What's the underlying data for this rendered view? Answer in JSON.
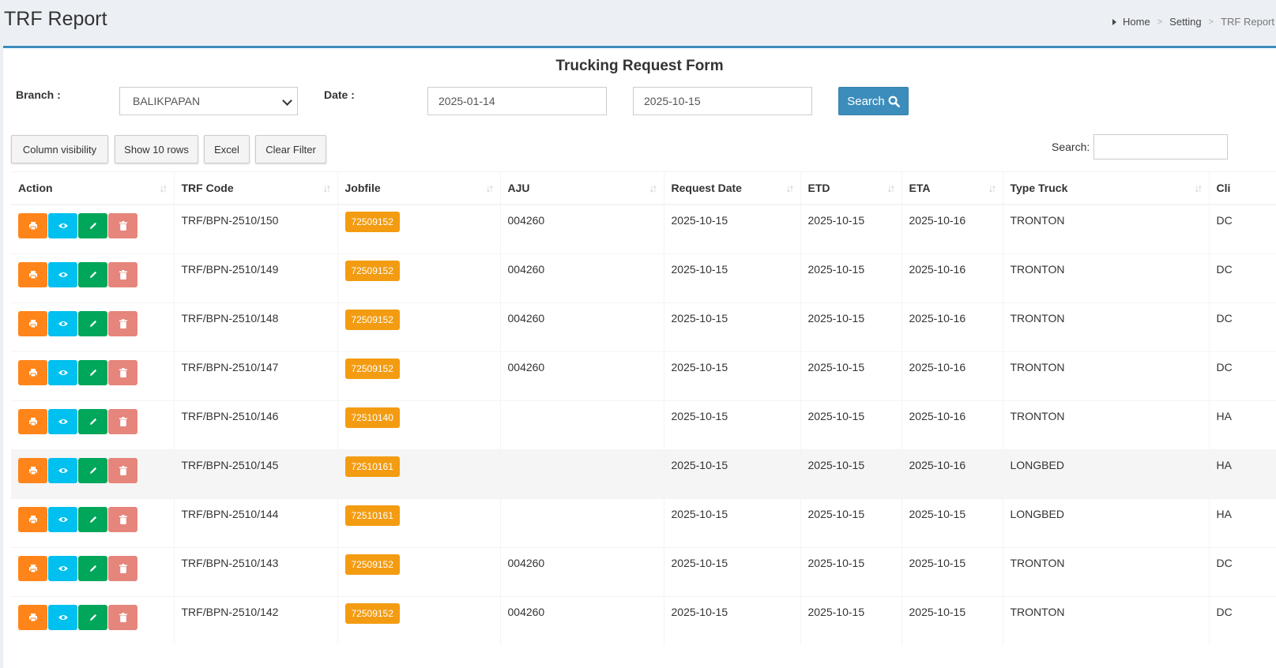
{
  "page": {
    "title": "TRF Report"
  },
  "breadcrumb": {
    "items": [
      "Home",
      "Setting",
      "TRF Report"
    ]
  },
  "form": {
    "title": "Trucking Request Form",
    "branch_label": "Branch :",
    "branch_value": "BALIKPAPAN",
    "date_label": "Date :",
    "date_from": "2025-01-14",
    "date_to": "2025-10-15",
    "search_button": "Search"
  },
  "toolbar": {
    "column_visibility": "Column visibility",
    "show_rows": "Show 10 rows",
    "excel": "Excel",
    "clear_filter": "Clear Filter",
    "search_label": "Search:",
    "search_value": ""
  },
  "colors": {
    "accent": "#3c8dbc",
    "print": "#ff851b",
    "view": "#00c0ef",
    "edit": "#00a65a",
    "delete": "#e6857b",
    "jobfile": "#f39c12"
  },
  "table": {
    "columns": [
      "Action",
      "TRF Code",
      "Jobfile",
      "AJU",
      "Request Date",
      "ETD",
      "ETA",
      "Type Truck",
      "Cli"
    ],
    "rows": [
      {
        "trf_code": "TRF/BPN-2510/150",
        "jobfile": "72509152",
        "aju": "004260",
        "request_date": "2025-10-15",
        "etd": "2025-10-15",
        "eta": "2025-10-16",
        "type_truck": "TRONTON",
        "client": "DC"
      },
      {
        "trf_code": "TRF/BPN-2510/149",
        "jobfile": "72509152",
        "aju": "004260",
        "request_date": "2025-10-15",
        "etd": "2025-10-15",
        "eta": "2025-10-16",
        "type_truck": "TRONTON",
        "client": "DC"
      },
      {
        "trf_code": "TRF/BPN-2510/148",
        "jobfile": "72509152",
        "aju": "004260",
        "request_date": "2025-10-15",
        "etd": "2025-10-15",
        "eta": "2025-10-16",
        "type_truck": "TRONTON",
        "client": "DC"
      },
      {
        "trf_code": "TRF/BPN-2510/147",
        "jobfile": "72509152",
        "aju": "004260",
        "request_date": "2025-10-15",
        "etd": "2025-10-15",
        "eta": "2025-10-16",
        "type_truck": "TRONTON",
        "client": "DC"
      },
      {
        "trf_code": "TRF/BPN-2510/146",
        "jobfile": "72510140",
        "aju": "",
        "request_date": "2025-10-15",
        "etd": "2025-10-15",
        "eta": "2025-10-16",
        "type_truck": "TRONTON",
        "client": "HA"
      },
      {
        "trf_code": "TRF/BPN-2510/145",
        "jobfile": "72510161",
        "aju": "",
        "request_date": "2025-10-15",
        "etd": "2025-10-15",
        "eta": "2025-10-16",
        "type_truck": "LONGBED",
        "client": "HA"
      },
      {
        "trf_code": "TRF/BPN-2510/144",
        "jobfile": "72510161",
        "aju": "",
        "request_date": "2025-10-15",
        "etd": "2025-10-15",
        "eta": "2025-10-15",
        "type_truck": "LONGBED",
        "client": "HA"
      },
      {
        "trf_code": "TRF/BPN-2510/143",
        "jobfile": "72509152",
        "aju": "004260",
        "request_date": "2025-10-15",
        "etd": "2025-10-15",
        "eta": "2025-10-15",
        "type_truck": "TRONTON",
        "client": "DC"
      },
      {
        "trf_code": "TRF/BPN-2510/142",
        "jobfile": "72509152",
        "aju": "004260",
        "request_date": "2025-10-15",
        "etd": "2025-10-15",
        "eta": "2025-10-15",
        "type_truck": "TRONTON",
        "client": "DC"
      }
    ]
  }
}
